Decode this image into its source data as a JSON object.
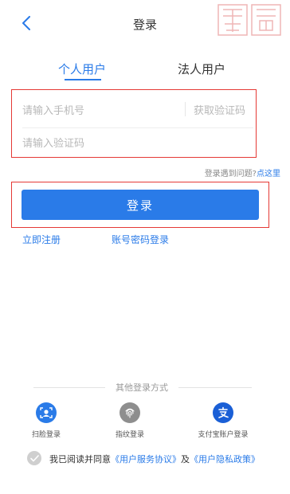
{
  "header": {
    "title": "登录",
    "back_icon": "chevron-left-icon",
    "watermark_text": "揚州"
  },
  "tabs": [
    {
      "label": "个人用户",
      "active": true
    },
    {
      "label": "法人用户",
      "active": false
    }
  ],
  "form": {
    "phone_placeholder": "请输入手机号",
    "get_code_label": "获取验证码",
    "code_placeholder": "请输入验证码"
  },
  "help": {
    "prefix": "登录遇到问题?",
    "link": "点这里"
  },
  "login_button": "登录",
  "links": {
    "register": "立即注册",
    "password_login": "账号密码登录"
  },
  "other_login": {
    "title": "其他登录方式",
    "options": [
      {
        "label": "扫脸登录",
        "icon": "face-scan-icon"
      },
      {
        "label": "指纹登录",
        "icon": "fingerprint-icon"
      },
      {
        "label": "支付宝账户登录",
        "icon": "alipay-icon"
      }
    ]
  },
  "agreement": {
    "prefix": "我已阅读并同意",
    "service": "《用户服务协议》",
    "and": "及",
    "privacy": "《用户隐私政策》"
  },
  "colors": {
    "accent": "#2a7be8",
    "highlight": "#e53935"
  }
}
